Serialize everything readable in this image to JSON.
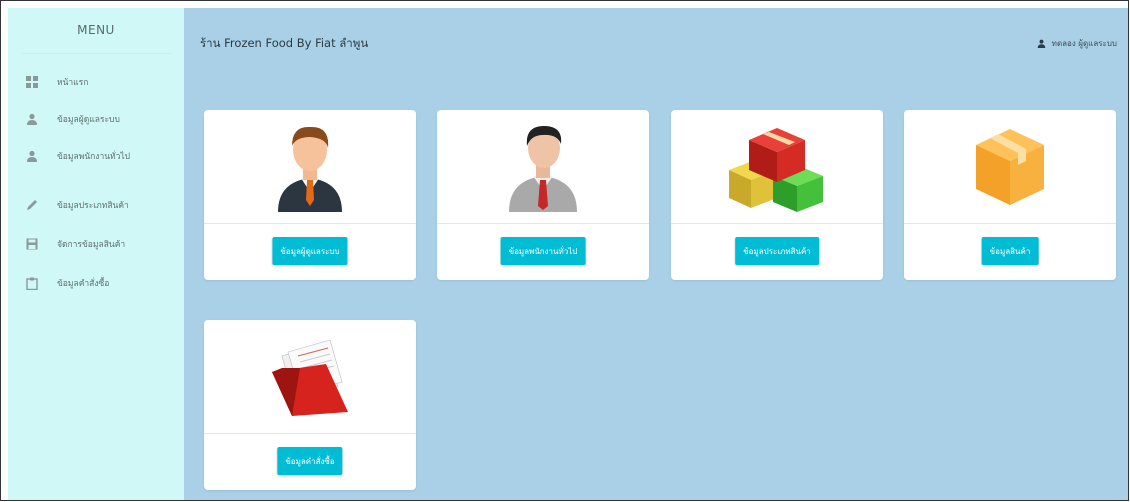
{
  "sidebar": {
    "menu_title": "MENU",
    "items": [
      {
        "label": "หน้าแรก",
        "icon": "dashboard-icon"
      },
      {
        "label": "ข้อมูลผู้ดูแลระบบ",
        "icon": "user-icon"
      },
      {
        "label": "ข้อมูลพนักงานทั่วไป",
        "icon": "user-icon"
      },
      {
        "label": "ข้อมูลประเภทสินค้า",
        "icon": "pencil-icon"
      },
      {
        "label": "จัดการข้อมูลสินค้า",
        "icon": "save-icon"
      },
      {
        "label": "ข้อมูลคำสั่งซื้อ",
        "icon": "clipboard-icon"
      }
    ]
  },
  "header": {
    "store_title": "ร้าน Frozen Food By Fiat ลำพูน",
    "user_label": "ทดลอง ผู้ดูแลระบบ"
  },
  "cards": [
    {
      "button_label": "ข้อมูลผู้ดูแลระบบ",
      "image": "admin-avatar"
    },
    {
      "button_label": "ข้อมูลพนักงานทั่วไป",
      "image": "employee-avatar"
    },
    {
      "button_label": "ข้อมูลประเภทสินค้า",
      "image": "boxes"
    },
    {
      "button_label": "ข้อมูลสินค้า",
      "image": "box"
    },
    {
      "button_label": "ข้อมูลคำสั่งซื้อ",
      "image": "red-folder"
    }
  ],
  "colors": {
    "sidebar_bg": "#cff8f6",
    "main_bg": "#a9d0e6",
    "button": "#00bcd4"
  }
}
